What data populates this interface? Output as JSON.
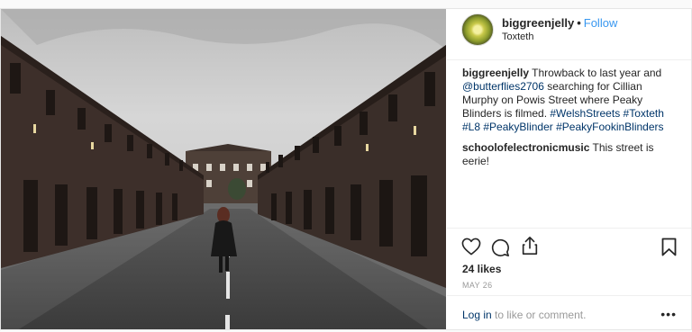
{
  "post": {
    "username": "biggreenjelly",
    "separator": "•",
    "follow_label": "Follow",
    "location": "Toxteth"
  },
  "caption": {
    "username": "biggreenjelly",
    "text_1": "Throwback to last year and",
    "mention": "@butterflies2706",
    "text_2": "searching for Cillian Murphy on Powis Street where Peaky Blinders is filmed.",
    "tags": [
      "#WelshStreets",
      "#Toxteth",
      "#L8",
      "#PeakyBlinder",
      "#PeakyFookinBlinders"
    ]
  },
  "comment": {
    "username": "schoolofelectronicmusic",
    "text": "This street is eerie!"
  },
  "actions": {
    "icons": [
      "heart-icon",
      "comment-icon",
      "share-icon",
      "bookmark-icon"
    ]
  },
  "likes": "24 likes",
  "date": "MAY 26",
  "footer": {
    "login_label": "Log in",
    "login_suffix": "to like or comment.",
    "more_label": "•••"
  },
  "colors": {
    "link": "#003569",
    "follow": "#3897f0",
    "muted": "#999999",
    "text": "#262626"
  }
}
